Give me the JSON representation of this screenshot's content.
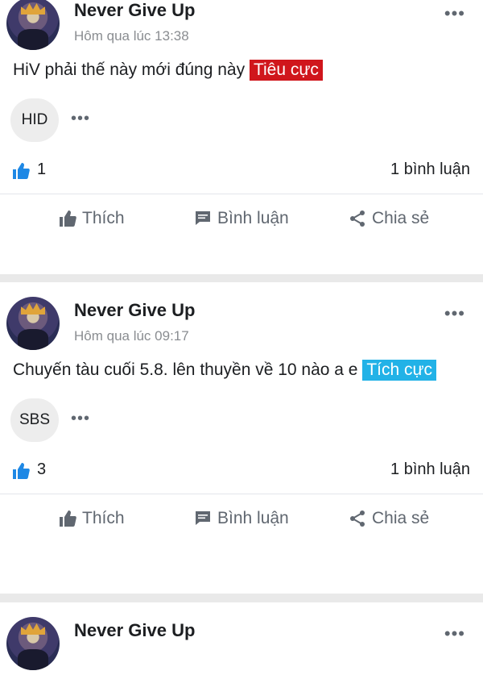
{
  "posts": [
    {
      "author": "Never Give Up",
      "time": "Hôm qua lúc 13:38",
      "text": "HiV phải thế này mới đúng này",
      "tag": "Tiêu cực",
      "tag_color": "#d0161c",
      "chip": "HID",
      "likes": "1",
      "comments": "1 bình luận"
    },
    {
      "author": "Never Give Up",
      "time": "Hôm qua lúc 09:17",
      "text": "Chuyến tàu cuối 5.8. lên thuyền về 10 nào a e",
      "tag": "Tích cực",
      "tag_color": "#22b2e7",
      "chip": "SBS",
      "likes": "3",
      "comments": "1 bình luận"
    },
    {
      "author": "Never Give Up"
    }
  ],
  "actions": {
    "like": "Thích",
    "comment": "Bình luận",
    "share": "Chia sẻ"
  },
  "icons": {
    "more": "more-horizontal-icon",
    "like": "thumbs-up-icon",
    "comment": "comment-icon",
    "share": "share-icon"
  },
  "colors": {
    "accent": "#1877f2",
    "text": "#1c1e21",
    "muted": "#606770"
  }
}
